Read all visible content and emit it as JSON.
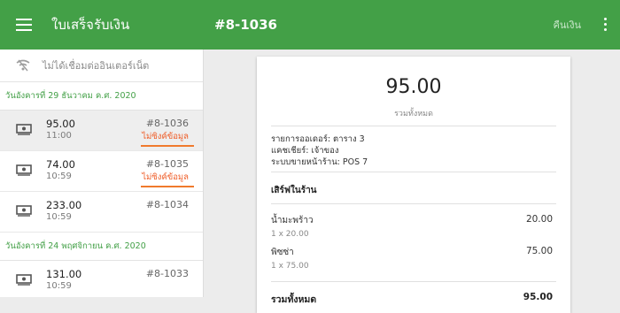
{
  "toolbar": {
    "app_title": "ใบเสร็จรับเงิน",
    "receipt_number": "#8-1036",
    "refund_label": "คืนเงิน"
  },
  "sidebar": {
    "offline_text": "ไม่ได้เชื่อมต่ออินเตอร์เน็ต",
    "groups": [
      {
        "date": "วันอังคารที่ 29 ธันวาคม ค.ศ. 2020",
        "receipts": [
          {
            "amount": "95.00",
            "time": "11:00",
            "number": "#8-1036",
            "sync": "ไม่ซิงค์ข้อมูล",
            "selected": true
          },
          {
            "amount": "74.00",
            "time": "10:59",
            "number": "#8-1035",
            "sync": "ไม่ซิงค์ข้อมูล"
          },
          {
            "amount": "233.00",
            "time": "10:59",
            "number": "#8-1034"
          }
        ]
      },
      {
        "date": "วันอังคารที่ 24 พฤศจิกายน ค.ศ. 2020",
        "receipts": [
          {
            "amount": "131.00",
            "time": "10:59",
            "number": "#8-1033"
          }
        ]
      }
    ]
  },
  "receipt": {
    "total": "95.00",
    "total_caption": "รวมทั้งหมด",
    "order": "รายการออเดอร์: ตาราง 3",
    "cashier": "แคชเชียร์: เจ้าของ",
    "pos": "ระบบขายหน้าร้าน: POS 7",
    "dining": "เสิร์ฟในร้าน",
    "items": [
      {
        "name": "น้ำมะพร้าว",
        "qty": "1 x 20.00",
        "price": "20.00"
      },
      {
        "name": "พิซซ่า",
        "qty": "1 x 75.00",
        "price": "75.00"
      }
    ],
    "total_label": "รวมทั้งหมด",
    "total_value": "95.00"
  },
  "colors": {
    "accent": "#43a047",
    "warning": "#ef5b25",
    "underline": "#f07a2c"
  },
  "icons": [
    "menu-icon",
    "wifi-off-icon",
    "cash-icon",
    "more-vert-icon"
  ]
}
